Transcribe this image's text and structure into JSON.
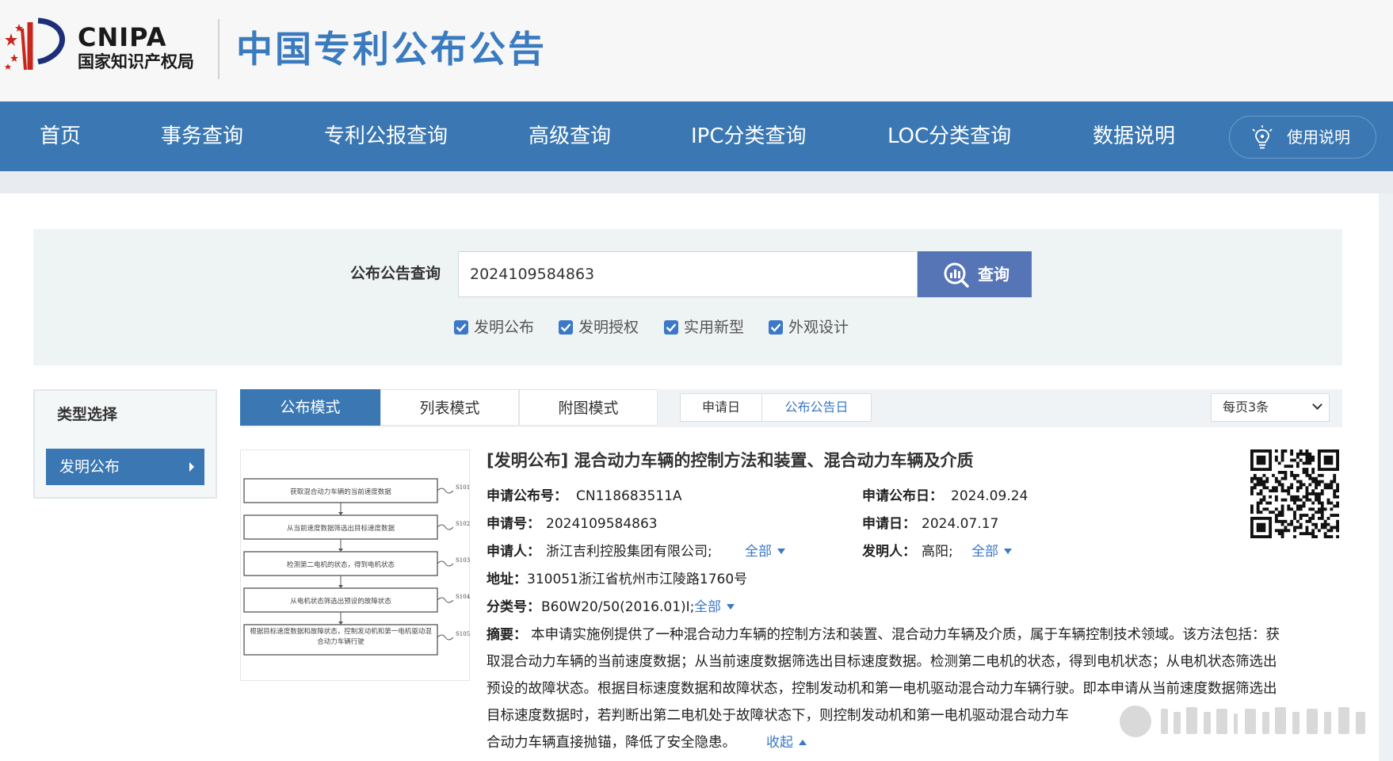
{
  "header": {
    "logo_en": "CNIPA",
    "logo_cn": "国家知识产权局",
    "site_title": "中国专利公布公告"
  },
  "nav": {
    "items": [
      "首页",
      "事务查询",
      "专利公报查询",
      "高级查询",
      "IPC分类查询",
      "LOC分类查询",
      "数据说明"
    ],
    "help_label": "使用说明"
  },
  "search": {
    "label": "公布公告查询",
    "value": "2024109584863",
    "button_label": "查询",
    "checkboxes": [
      {
        "label": "发明公布",
        "checked": true
      },
      {
        "label": "发明授权",
        "checked": true
      },
      {
        "label": "实用新型",
        "checked": true
      },
      {
        "label": "外观设计",
        "checked": true
      }
    ]
  },
  "filter": {
    "title": "类型选择",
    "items": [
      "发明公布"
    ]
  },
  "view": {
    "tabs": [
      "公布模式",
      "列表模式",
      "附图模式"
    ],
    "active_tab": "公布模式",
    "sort_options": [
      "申请日",
      "公布公告日"
    ],
    "active_sort": "公布公告日",
    "per_page": "每页3条"
  },
  "result": {
    "title": "[发明公布] 混合动力车辆的控制方法和装置、混合动力车辆及介质",
    "pub_no_label": "申请公布号：",
    "pub_no": "CN118683511A",
    "pub_date_label": "申请公布日：",
    "pub_date": "2024.09.24",
    "app_no_label": "申请号：",
    "app_no": "2024109584863",
    "app_date_label": "申请日：",
    "app_date": "2024.07.17",
    "applicant_label": "申请人：",
    "applicant": "浙江吉利控股集团有限公司;",
    "inventor_label": "发明人：",
    "inventor": "高阳;",
    "all_label": "全部",
    "address_label": "地址：",
    "address": "310051浙江省杭州市江陵路1760号",
    "class_label": "分类号：",
    "class_no": "B60W20/50(2016.01)I;",
    "abstract_label": "摘要：",
    "abstract_lines": [
      "本申请实施例提供了一种混合动力车辆的控制方法和装置、混合动力车辆及介质，属于车辆控制技术领域。该方法包括：获",
      "取混合动力车辆的当前速度数据；从当前速度数据筛选出目标速度数据。检测第二电机的状态，得到电机状态；从电机状态筛选出",
      "预设的故障状态。根据目标速度数据和故障状态，控制发动机和第一电机驱动混合动力车辆行驶。即本申请从当前速度数据筛选出",
      "目标速度数据时，若判断出第二电机处于故障状态下，则控制发动机和第一电机驱动混合动力车",
      "合动力车辆直接抛锚，降低了安全隐患。"
    ],
    "collapse_label": "收起",
    "flow_steps": [
      {
        "text": "获取混合动力车辆的当前速度数据",
        "id": "S101"
      },
      {
        "text": "从当前速度数据筛选出目标速度数据",
        "id": "S102"
      },
      {
        "text": "检测第二电机的状态，得到电机状态",
        "id": "S103"
      },
      {
        "text": "从电机状态筛选出预设的故障状态",
        "id": "S104"
      },
      {
        "text": "根据目标速度数据和故障状态，控制发动机和第一电机驱动混合动力车辆行驶",
        "id": "S105"
      }
    ]
  },
  "colors": {
    "nav_bg": "#3b78b3",
    "title_blue": "#3a7bbf",
    "button_bg": "#5575b7",
    "link_blue": "#3b78c7"
  }
}
